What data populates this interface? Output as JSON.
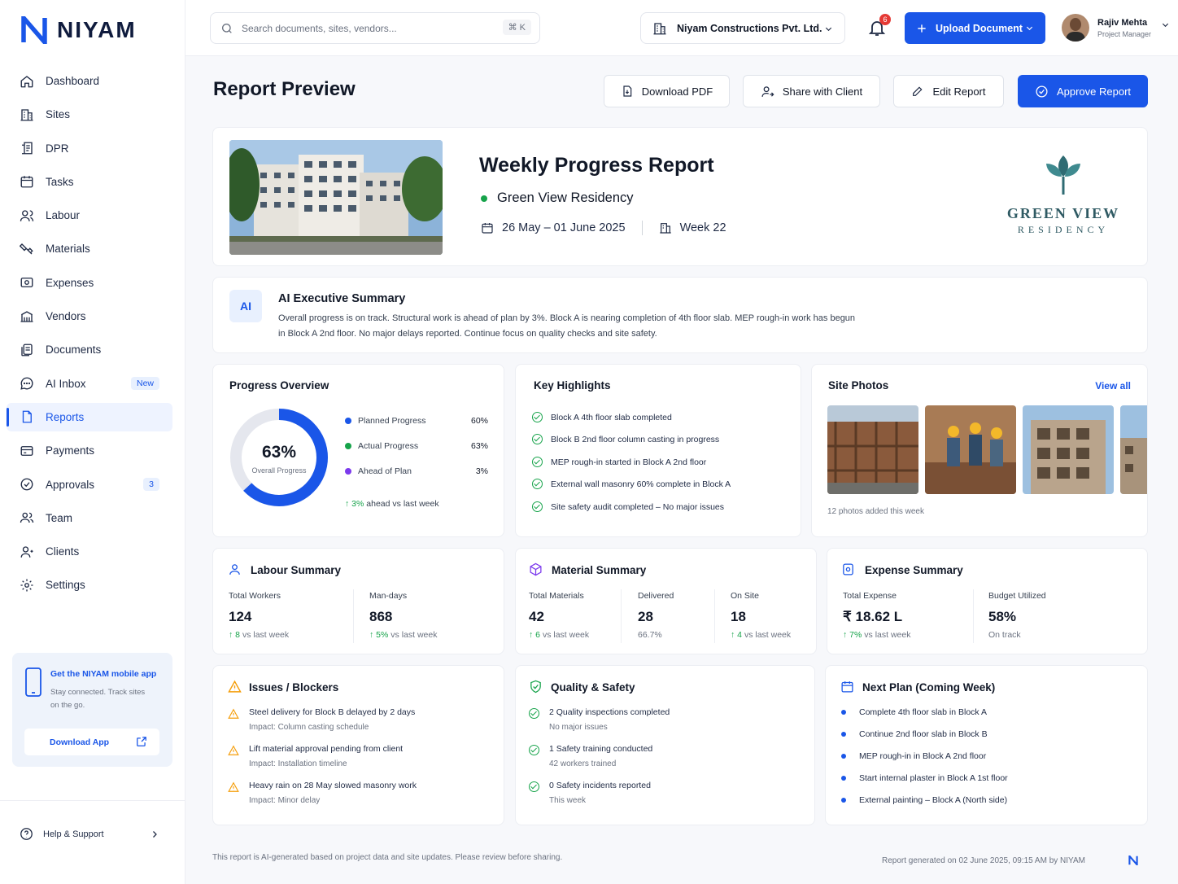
{
  "brand": {
    "name": "NIYAM"
  },
  "sidebar": {
    "items": [
      {
        "label": "Dashboard",
        "icon": "home-icon"
      },
      {
        "label": "Sites",
        "icon": "building-icon"
      },
      {
        "label": "DPR",
        "icon": "dpr-icon"
      },
      {
        "label": "Tasks",
        "icon": "calendar-icon"
      },
      {
        "label": "Labour",
        "icon": "labour-icon"
      },
      {
        "label": "Materials",
        "icon": "materials-icon"
      },
      {
        "label": "Expenses",
        "icon": "expenses-icon"
      },
      {
        "label": "Vendors",
        "icon": "vendors-icon"
      },
      {
        "label": "Documents",
        "icon": "documents-icon"
      },
      {
        "label": "AI Inbox",
        "icon": "chat-icon",
        "badge": "New"
      },
      {
        "label": "Reports",
        "icon": "report-icon",
        "active": true
      },
      {
        "label": "Payments",
        "icon": "card-icon"
      },
      {
        "label": "Approvals",
        "icon": "check-circle-icon",
        "badge": "3"
      },
      {
        "label": "Team",
        "icon": "team-icon"
      },
      {
        "label": "Clients",
        "icon": "clients-icon"
      },
      {
        "label": "Settings",
        "icon": "gear-icon"
      }
    ],
    "promo": {
      "title": "Get the NIYAM mobile app",
      "subtitle": "Stay connected. Track sites on the go.",
      "button": "Download App"
    },
    "help": "Help & Support"
  },
  "topbar": {
    "search_placeholder": "Search documents, sites, vendors...",
    "shortcut": "⌘ K",
    "company": "Niyam Constructions Pvt. Ltd.",
    "notifications": "6",
    "upload": "Upload Document",
    "user": {
      "name": "Rajiv Mehta",
      "role": "Project Manager"
    }
  },
  "page": {
    "title": "Report Preview",
    "actions": {
      "download": "Download PDF",
      "share": "Share with Client",
      "edit": "Edit Report",
      "approve": "Approve Report"
    }
  },
  "report": {
    "title": "Weekly Progress Report",
    "project": "Green View Residency",
    "dates": "26 May – 01 June 2025",
    "week": "Week 22",
    "logo": {
      "name": "GREEN VIEW",
      "sub": "RESIDENCY"
    }
  },
  "summary": {
    "icon_text": "AI",
    "title": "AI Executive Summary",
    "text": "Overall progress is on track. Structural work is ahead of plan by 3%. Block A is nearing completion of 4th floor slab. MEP rough-in work has begun in Block A 2nd floor. No major delays reported. Continue focus on quality checks and site safety."
  },
  "progress": {
    "title": "Progress Overview",
    "value": "63%",
    "value_num": 63,
    "label": "Overall Progress",
    "legend": [
      {
        "label": "Planned Progress",
        "value": "60%",
        "color": "#1a56e8"
      },
      {
        "label": "Actual Progress",
        "value": "63%",
        "color": "#16a34a"
      },
      {
        "label": "Ahead of Plan",
        "value": "3%",
        "color": "#7c3aed"
      }
    ],
    "trend": "3%",
    "trend_text": "ahead vs last week"
  },
  "highlights": {
    "title": "Key Highlights",
    "items": [
      "Block A 4th floor slab completed",
      "Block B 2nd floor column casting in progress",
      "MEP rough-in started in Block A 2nd floor",
      "External wall masonry 60% complete in Block A",
      "Site safety audit completed – No major issues"
    ]
  },
  "photos": {
    "title": "Site Photos",
    "link": "View all",
    "caption": "12 photos added this week"
  },
  "labour": {
    "title": "Labour Summary",
    "workers_label": "Total Workers",
    "workers": "124",
    "workers_trend": "8",
    "workers_trend_text": "vs last week",
    "mandays_label": "Man-days",
    "mandays": "868",
    "mandays_trend": "5%",
    "mandays_trend_text": "vs last week"
  },
  "material": {
    "title": "Material Summary",
    "total_label": "Total Materials",
    "total": "42",
    "total_trend": "6",
    "total_trend_text": "vs last week",
    "delivered_label": "Delivered",
    "delivered": "28",
    "delivered_pct": "66.7%",
    "onsite_label": "On Site",
    "onsite": "18",
    "onsite_trend": "4",
    "onsite_trend_text": "vs last week"
  },
  "expense": {
    "title": "Expense Summary",
    "total_label": "Total Expense",
    "total": "₹ 18.62 L",
    "total_trend": "7%",
    "total_trend_text": "vs last week",
    "budget_label": "Budget Utilized",
    "budget": "58%",
    "budget_status": "On track"
  },
  "issues": {
    "title": "Issues / Blockers",
    "items": [
      {
        "text": "Steel delivery for Block B delayed by 2 days",
        "sub": "Impact: Column casting schedule"
      },
      {
        "text": "Lift material approval pending from client",
        "sub": "Impact: Installation timeline"
      },
      {
        "text": "Heavy rain on 28 May slowed masonry work",
        "sub": "Impact: Minor delay"
      }
    ]
  },
  "quality": {
    "title": "Quality & Safety",
    "items": [
      {
        "text": "2 Quality inspections completed",
        "sub": "No major issues"
      },
      {
        "text": "1 Safety training conducted",
        "sub": "42 workers trained"
      },
      {
        "text": "0 Safety incidents reported",
        "sub": "This week"
      }
    ]
  },
  "next_plan": {
    "title": "Next Plan (Coming Week)",
    "items": [
      "Complete 4th floor slab in Block A",
      "Continue 2nd floor slab in Block B",
      "MEP rough-in in Block A 2nd floor",
      "Start internal plaster in Block A 1st floor",
      "External painting – Block A (North side)"
    ]
  },
  "footer": {
    "note": "This report is AI-generated based on project data and site updates. Please review before sharing.",
    "generated": "Report generated on 02 June 2025, 09:15 AM by NIYAM"
  },
  "colors": {
    "accent": "#1a56e8",
    "success": "#16a34a",
    "warning": "#f59e0b",
    "purple": "#7c3aed"
  }
}
